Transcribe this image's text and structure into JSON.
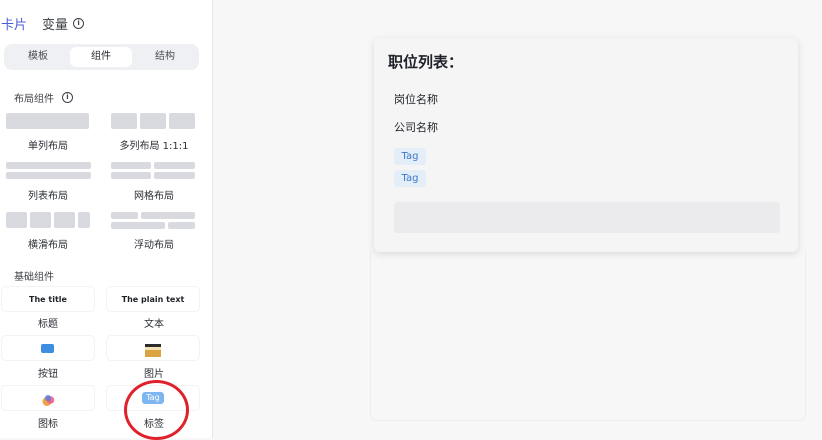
{
  "top_tabs": {
    "card": "卡片",
    "variables": "变量"
  },
  "segment_tabs": [
    "模板",
    "组件",
    "结构"
  ],
  "segment_active": "组件",
  "layout_section": {
    "title": "布局组件",
    "info": "i"
  },
  "layout_components": [
    "单列布局",
    "多列布局 1:1:1",
    "列表布局",
    "网格布局",
    "横滑布局",
    "浮动布局"
  ],
  "basic_section": {
    "title": "基础组件"
  },
  "basic_components": {
    "title_sample": "The title",
    "title_label": "标题",
    "text_sample": "The plain text",
    "text_label": "文本",
    "button_label": "按钮",
    "image_label": "图片",
    "icon_label": "图标",
    "tag_sample": "Tag",
    "tag_label": "标签"
  },
  "card": {
    "title": "职位列表：",
    "line1": "岗位名称",
    "line2": "公司名称",
    "tags": [
      "Tag",
      "Tag"
    ]
  },
  "colors": {
    "accent": "#4e5fd6",
    "highlight_circle": "#e0202b",
    "tag_bg": "#e3eef9",
    "tag_text": "#3d78c9"
  }
}
